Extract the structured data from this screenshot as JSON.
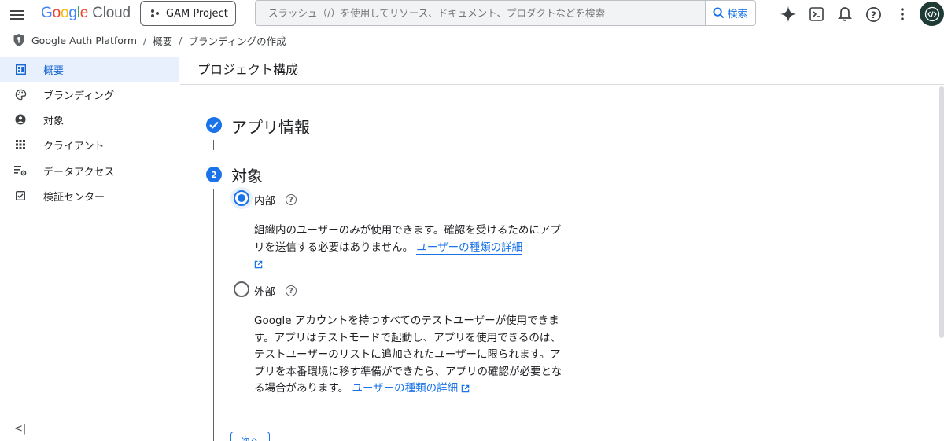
{
  "topbar": {
    "logo_google": [
      "G",
      "o",
      "o",
      "g",
      "l",
      "e"
    ],
    "logo_cloud": "Cloud",
    "project": "GAM Project",
    "search_placeholder": "スラッシュ（/）を使用してリソース、ドキュメント、プロダクトなどを検索",
    "search_button": "検索"
  },
  "breadcrumb": {
    "items": [
      "Google Auth Platform",
      "概要",
      "ブランディングの作成"
    ],
    "separator": "/"
  },
  "sidebar": {
    "items": [
      {
        "label": "概要",
        "icon": "dashboard-icon"
      },
      {
        "label": "ブランディング",
        "icon": "palette-icon"
      },
      {
        "label": "対象",
        "icon": "person-icon"
      },
      {
        "label": "クライアント",
        "icon": "grid-icon"
      },
      {
        "label": "データアクセス",
        "icon": "data-settings-icon"
      },
      {
        "label": "検証センター",
        "icon": "checkbox-icon"
      }
    ],
    "collapse_label": "<|"
  },
  "main": {
    "title": "プロジェクト構成",
    "step1": {
      "title": "アプリ情報"
    },
    "step2": {
      "number": "2",
      "title": "対象",
      "options": [
        {
          "label": "内部",
          "selected": true,
          "desc": "組織内のユーザーのみが使用できます。確認を受けるためにアプリを送信する必要はありません。",
          "link": "ユーザーの種類の詳細"
        },
        {
          "label": "外部",
          "selected": false,
          "desc": "Google アカウントを持つすべてのテストユーザーが使用できます。アプリはテストモードで起動し、アプリを使用できるのは、テストユーザーのリストに追加されたユーザーに限られます。アプリを本番環境に移す準備ができたら、アプリの確認が必要となる場合があります。",
          "link": "ユーザーの種類の詳細"
        }
      ]
    },
    "next_button": "次へ"
  },
  "colors": {
    "accent": "#1a73e8",
    "active_bg": "#e8f0fe"
  }
}
